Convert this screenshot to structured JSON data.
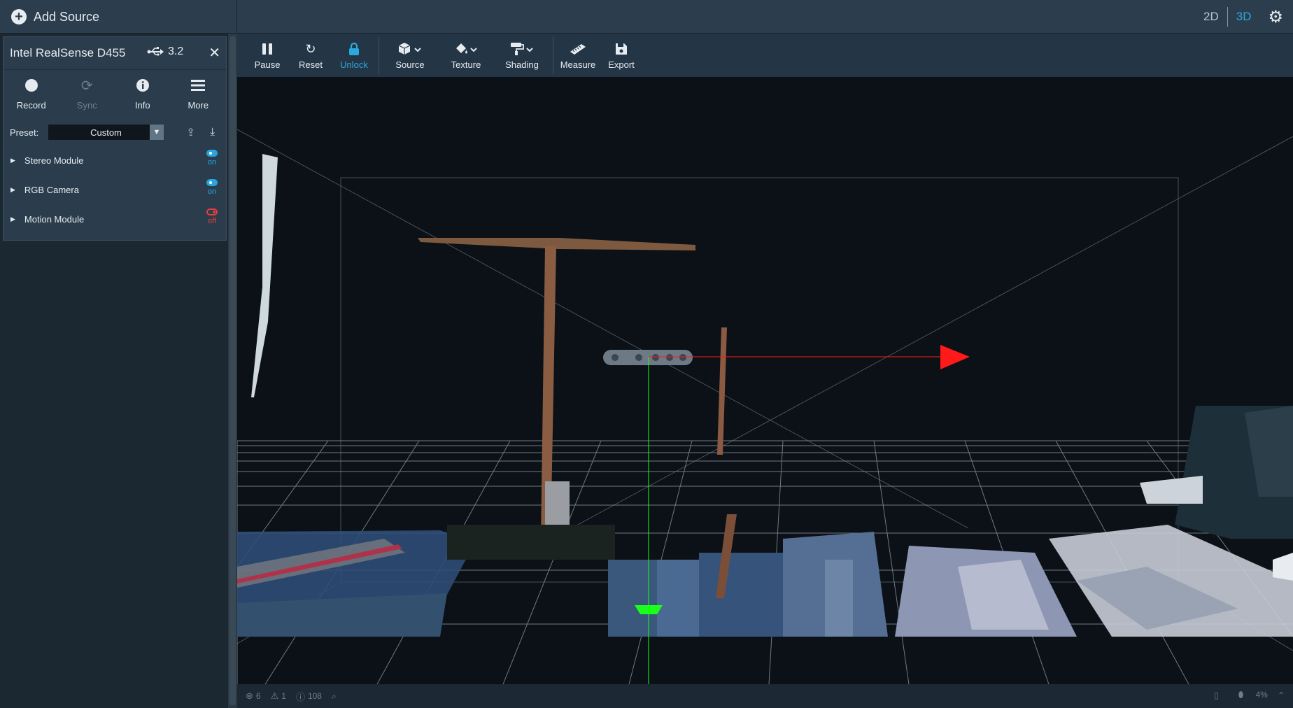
{
  "topbar": {
    "add_source_label": "Add Source",
    "view_2d": "2D",
    "view_3d": "3D",
    "active_view": "3D"
  },
  "device": {
    "name": "Intel RealSense D455",
    "usb_version": "3.2",
    "actions": [
      {
        "label": "Record",
        "icon": "record-icon",
        "enabled": true
      },
      {
        "label": "Sync",
        "icon": "sync-icon",
        "enabled": false
      },
      {
        "label": "Info",
        "icon": "info-icon",
        "enabled": true
      },
      {
        "label": "More",
        "icon": "menu-icon",
        "enabled": true
      }
    ],
    "preset_label": "Preset:",
    "preset_value": "Custom",
    "modules": [
      {
        "label": "Stereo Module",
        "state": "on"
      },
      {
        "label": "RGB Camera",
        "state": "on"
      },
      {
        "label": "Motion Module",
        "state": "off"
      }
    ]
  },
  "toolbar": {
    "items": [
      {
        "label": "Pause",
        "icon": "pause-icon"
      },
      {
        "label": "Reset",
        "icon": "reset-icon"
      },
      {
        "label": "Unlock",
        "icon": "lock-icon",
        "active": true
      },
      {
        "label": "Source",
        "icon": "cube-icon"
      },
      {
        "label": "Texture",
        "icon": "paint-bucket-icon"
      },
      {
        "label": "Shading",
        "icon": "paint-roller-icon"
      },
      {
        "label": "Measure",
        "icon": "ruler-icon"
      },
      {
        "label": "Export",
        "icon": "save-icon"
      }
    ]
  },
  "statusbar": {
    "errors": "6",
    "warnings": "1",
    "info": "108",
    "fill": "4%"
  },
  "colors": {
    "accent": "#2aa8e0",
    "off": "#e83e3e",
    "x_axis": "#ff1a1a",
    "y_axis": "#1aff1a"
  }
}
